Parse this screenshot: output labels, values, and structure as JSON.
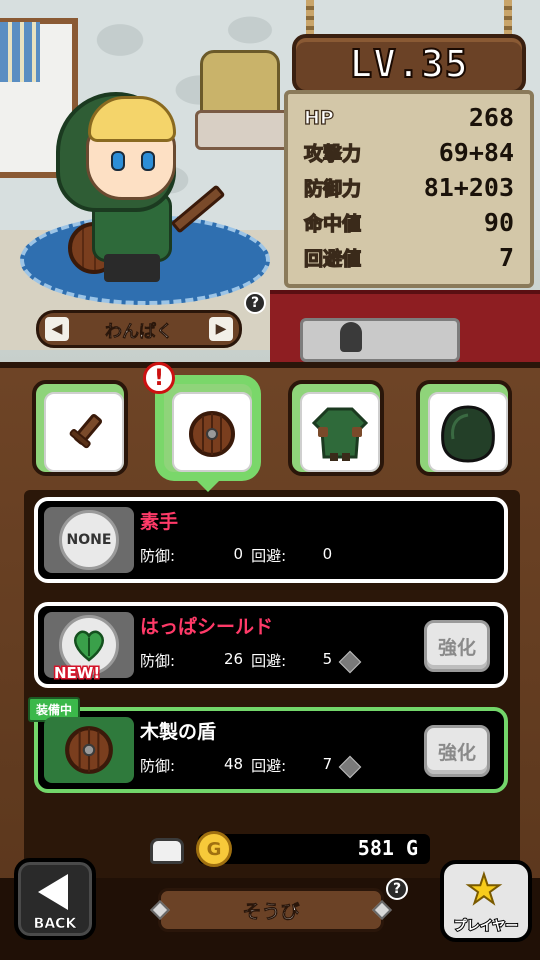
{
  "hero": {
    "level_label": "LV.35",
    "job_name": "わんぱく",
    "prev_arrow": "◀",
    "next_arrow": "▶",
    "help_mark": "?"
  },
  "stats": [
    {
      "label": "HP",
      "value": "268"
    },
    {
      "label": "攻撃力",
      "value": "69+84"
    },
    {
      "label": "防御力",
      "value": "81+203"
    },
    {
      "label": "命中値",
      "value": "90"
    },
    {
      "label": "回避値",
      "value": "7"
    }
  ],
  "slots": [
    {
      "name": "weapon",
      "icon": "sword-icon",
      "active": false
    },
    {
      "name": "shield",
      "icon": "shield-icon",
      "active": true,
      "alert": "!"
    },
    {
      "name": "armor",
      "icon": "armor-icon",
      "active": false
    },
    {
      "name": "hood",
      "icon": "hood-icon",
      "active": false
    }
  ],
  "items": [
    {
      "name": "素手",
      "icon_text": "NONE",
      "def_label": "防御:",
      "def": "0",
      "eva_label": "回避:",
      "eva": "0"
    },
    {
      "name": "はっぱシールド",
      "badge": "NEW!",
      "def_label": "防御:",
      "def": "26",
      "eva_label": "回避:",
      "eva": "5",
      "upgrade_label": "強化"
    },
    {
      "name": "木製の盾",
      "equipped_label": "装備中",
      "def_label": "防御:",
      "def": "48",
      "eva_label": "回避:",
      "eva": "7",
      "upgrade_label": "強化"
    }
  ],
  "currency": {
    "coin_glyph": "G",
    "amount": "581",
    "unit": "G"
  },
  "nav": {
    "back_label": "BACK",
    "tab_label": "そうび",
    "player_label": "プレイヤー",
    "help_mark": "?"
  },
  "colors": {
    "item_name": "#ff3a68",
    "equipped_border": "#73d66a",
    "wood": "#6b4226",
    "gold": "#f7c93a"
  }
}
